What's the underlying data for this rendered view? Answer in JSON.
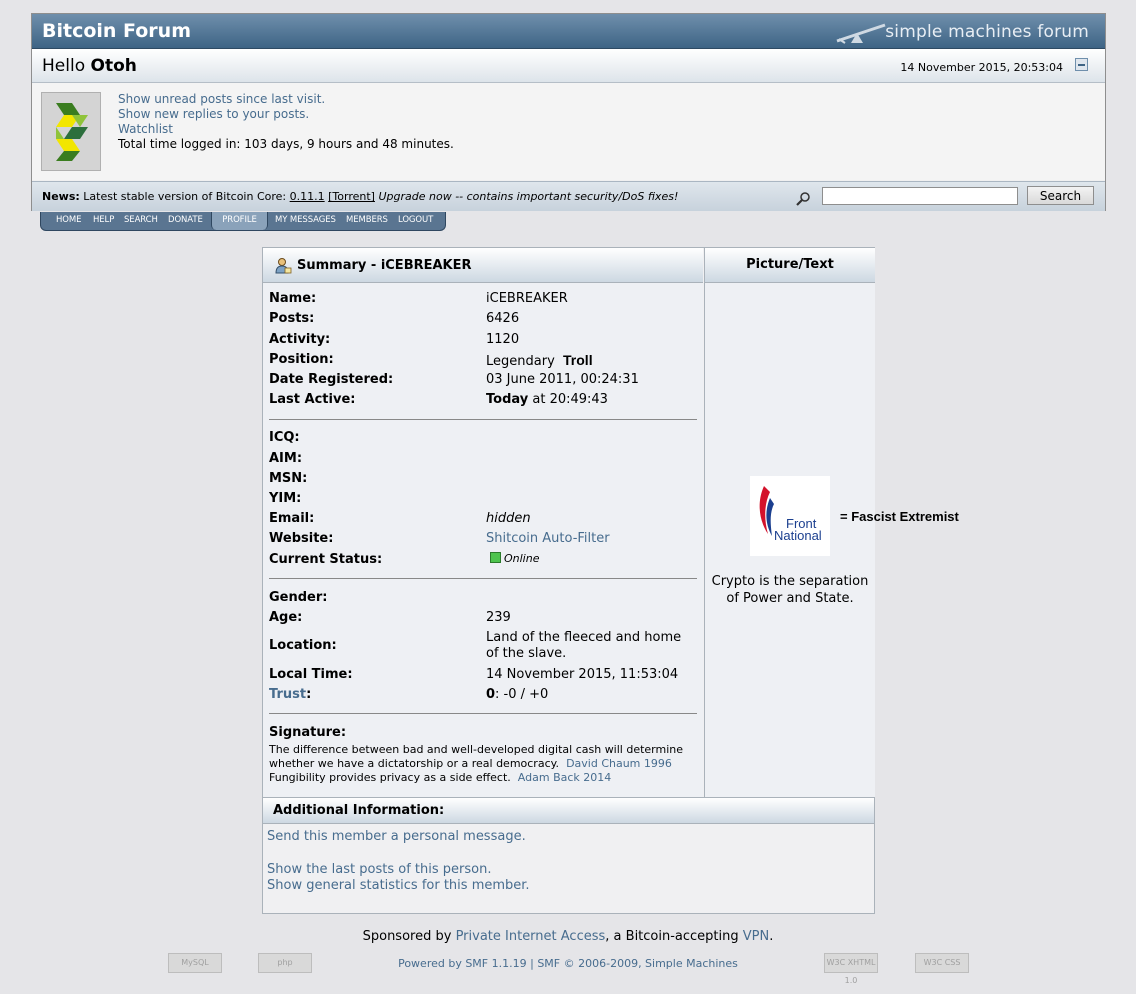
{
  "header": {
    "forum_title": "Bitcoin Forum",
    "smf_logo": "simple machines forum",
    "greeting": "Hello",
    "username": "Otoh",
    "datetime": "14 November 2015, 20:53:04",
    "user_links": {
      "unread": "Show unread posts since last visit.",
      "replies": "Show new replies to your posts.",
      "watchlist": "Watchlist",
      "time_logged": "Total time logged in: 103 days, 9 hours and 48 minutes."
    }
  },
  "news": {
    "label": "News:",
    "text_before": "Latest stable version of Bitcoin Core:",
    "version": "0.11.1",
    "torrent": "[Torrent]",
    "text_after": "Upgrade now -- contains important security/DoS fixes!"
  },
  "search": {
    "placeholder": "",
    "button": "Search"
  },
  "menu": [
    "HOME",
    "HELP",
    "SEARCH",
    "DONATE",
    "PROFILE",
    "MY MESSAGES",
    "MEMBERS",
    "LOGOUT"
  ],
  "profile": {
    "summary_title": "Summary - iCEBREAKER",
    "picture_title": "Picture/Text",
    "rows": {
      "name": {
        "label": "Name:",
        "value": "iCEBREAKER"
      },
      "posts": {
        "label": "Posts:",
        "value": "6426"
      },
      "activity": {
        "label": "Activity:",
        "value": "1120"
      },
      "position": {
        "label": "Position:",
        "value": "Legendary",
        "extra": "Troll"
      },
      "registered": {
        "label": "Date Registered:",
        "value": "03 June 2011, 00:24:31"
      },
      "last_active": {
        "label": "Last Active:",
        "value_bold": "Today",
        "value": "at 20:49:43"
      },
      "icq": {
        "label": "ICQ:"
      },
      "aim": {
        "label": "AIM:"
      },
      "msn": {
        "label": "MSN:"
      },
      "yim": {
        "label": "YIM:"
      },
      "email": {
        "label": "Email:",
        "value": "hidden"
      },
      "website": {
        "label": "Website:",
        "value": "Shitcoin Auto-Filter"
      },
      "status": {
        "label": "Current Status:",
        "value": "Online"
      },
      "gender": {
        "label": "Gender:"
      },
      "age": {
        "label": "Age:",
        "value": "239"
      },
      "location": {
        "label": "Location:",
        "value_line1": "Land of the fleeced and home",
        "value_line2": "of the slave."
      },
      "local_time": {
        "label": "Local Time:",
        "value": "14 November 2015, 11:53:04"
      },
      "trust": {
        "label": "Trust",
        "colon": ":",
        "value_bold": "0",
        "value": ": -0 / +0"
      }
    },
    "signature": {
      "label": "Signature:",
      "line1": "The difference between bad and well-developed digital cash will determine",
      "line2": "whether we have a dictatorship or a real democracy.",
      "line2_link": "David Chaum 1996",
      "line3": "Fungibility provides privacy as a side effect.",
      "line3_link": "Adam Back 2014"
    },
    "picture": {
      "logo_line1": "Front",
      "logo_line2": "National",
      "equals_text": "=  Fascist Extremist",
      "personal_text_line1": "Crypto is the separation",
      "personal_text_line2": "of Power and State."
    },
    "additional": {
      "title": "Additional Information:",
      "send_pm": "Send this member a personal message.",
      "last_posts": "Show the last posts of this person.",
      "stats": "Show general statistics for this member."
    }
  },
  "footer": {
    "sponsor_before": "Sponsored by",
    "sponsor_link": "Private Internet Access",
    "sponsor_middle": ", a Bitcoin-accepting",
    "sponsor_vpn": "VPN",
    "sponsor_end": ".",
    "powered": "Powered by SMF 1.1.19 | SMF © 2006-2009, Simple Machines",
    "badges": [
      "MySQL",
      "php",
      "W3C XHTML 1.0",
      "W3C CSS"
    ]
  },
  "colors": {
    "link": "#476c8e",
    "titlebar": "#3e6485",
    "online": "#4ec44e"
  }
}
